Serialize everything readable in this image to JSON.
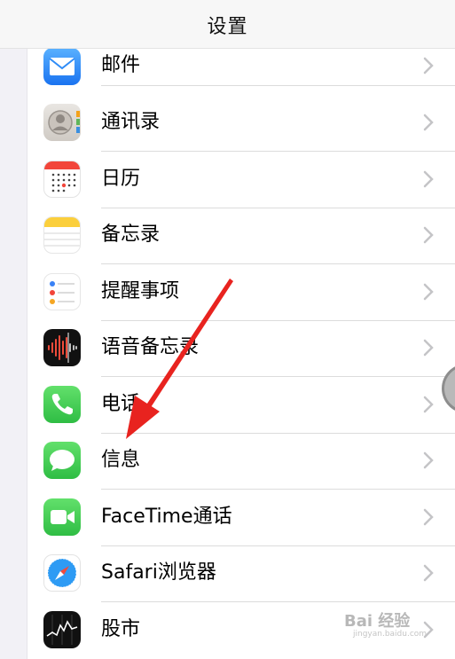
{
  "nav": {
    "title": "设置"
  },
  "rows": [
    {
      "label": "邮件",
      "icon": "mail-icon"
    },
    {
      "label": "通讯录",
      "icon": "contacts-icon"
    },
    {
      "label": "日历",
      "icon": "calendar-icon"
    },
    {
      "label": "备忘录",
      "icon": "notes-icon"
    },
    {
      "label": "提醒事项",
      "icon": "reminders-icon"
    },
    {
      "label": "语音备忘录",
      "icon": "voice-memos-icon"
    },
    {
      "label": "电话",
      "icon": "phone-icon"
    },
    {
      "label": "信息",
      "icon": "messages-icon"
    },
    {
      "label": "FaceTime通话",
      "icon": "facetime-icon"
    },
    {
      "label": "Safari浏览器",
      "icon": "safari-icon"
    },
    {
      "label": "股市",
      "icon": "stocks-icon"
    }
  ],
  "annotation": {
    "arrow_color": "#e8231f",
    "points_to": "信息"
  },
  "watermark": {
    "text": "Bai 经验",
    "sub": "jingyan.baidu.com"
  },
  "colors": {
    "mail": "#2f8cf7",
    "phone": "#34c759",
    "messages": "#34c759",
    "facetime": "#34c759",
    "accent": "#e8231f"
  }
}
